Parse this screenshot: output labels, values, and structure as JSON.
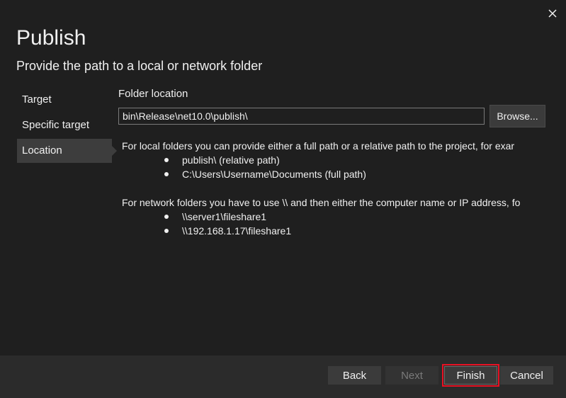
{
  "dialog": {
    "title": "Publish",
    "subtitle": "Provide the path to a local or network folder"
  },
  "nav": {
    "items": [
      {
        "label": "Target"
      },
      {
        "label": "Specific target"
      },
      {
        "label": "Location"
      }
    ],
    "selected": "Location"
  },
  "location": {
    "folder_label": "Folder location",
    "folder_value": "bin\\Release\\net10.0\\publish\\",
    "browse_label": "Browse...",
    "local_help": "For local folders you can provide either a full path or a relative path to the project, for exar",
    "local_examples": [
      "publish\\ (relative path)",
      "C:\\Users\\Username\\Documents (full path)"
    ],
    "network_help": "For network folders you have to use \\\\ and then either the computer name or IP address, fo",
    "network_examples": [
      "\\\\server1\\fileshare1",
      "\\\\192.168.1.17\\fileshare1"
    ]
  },
  "footer": {
    "back_label": "Back",
    "next_label": "Next",
    "finish_label": "Finish",
    "cancel_label": "Cancel"
  },
  "icons": {
    "close": "close-icon"
  },
  "colors": {
    "background": "#1f1f1f",
    "footer": "#2b2b2b",
    "selected_nav": "#3d3d3d",
    "highlight": "#e81123"
  }
}
